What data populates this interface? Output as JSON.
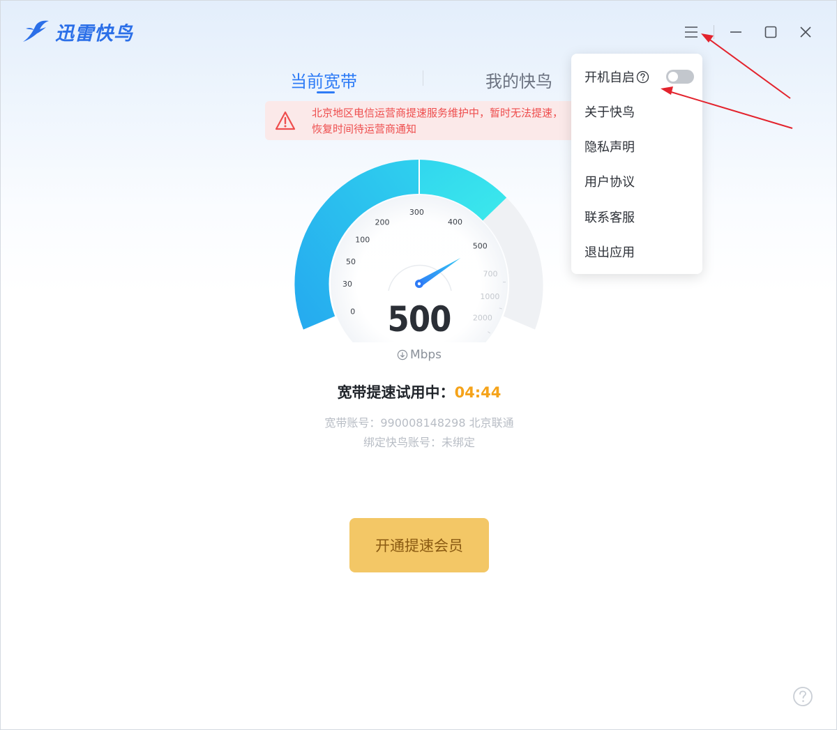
{
  "app": {
    "title": "迅雷快鸟"
  },
  "titlebar": {
    "menu_icon": "hamburger-icon",
    "minimize_icon": "minimize-icon",
    "maximize_icon": "maximize-icon",
    "close_icon": "close-icon"
  },
  "tabs": [
    {
      "label": "当前宽带",
      "active": true
    },
    {
      "label": "我的快鸟",
      "active": false
    }
  ],
  "notice": {
    "icon": "warning-icon",
    "text": "北京地区电信运营商提速服务维护中，暂时无法提速，恢复时间待运营商通知"
  },
  "gauge": {
    "value": 500,
    "unit": "Mbps",
    "unit_icon": "download-arrow-icon",
    "ticks": [
      "0",
      "30",
      "50",
      "100",
      "200",
      "300",
      "400",
      "500",
      "700",
      "1000",
      "2000"
    ]
  },
  "trial": {
    "label": "宽带提速试用中：",
    "timer": "04:44"
  },
  "account": {
    "broadband_line": "宽带账号：990008148298 北京联通",
    "binding_line": "绑定快鸟账号：未绑定"
  },
  "cta": {
    "label": "开通提速会员"
  },
  "help_icon": "help-circle-icon",
  "menu": {
    "items": [
      {
        "label": "开机自启",
        "has_help": true,
        "toggle": false
      },
      {
        "label": "关于快鸟"
      },
      {
        "label": "隐私声明"
      },
      {
        "label": "用户协议"
      },
      {
        "label": "联系客服"
      },
      {
        "label": "退出应用"
      }
    ]
  },
  "colors": {
    "accent": "#2e7bf6",
    "gauge_cyan": "#2fd9ee",
    "gauge_blue": "#27b4f0",
    "timer": "#f5a31a",
    "cta_bg": "#f3c766",
    "notice_text": "#ee4d4d",
    "annotation_arrow": "#e3232d"
  }
}
